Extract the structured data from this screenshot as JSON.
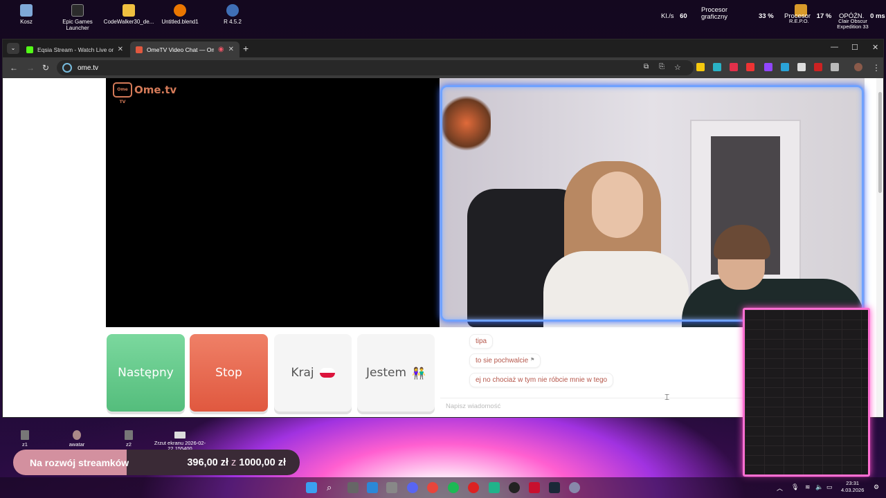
{
  "desktop": {
    "icons": [
      {
        "label": "Kosz",
        "icon": "recycle-bin-icon",
        "color": "#7fa9d8"
      },
      {
        "label": "Epic Games Launcher",
        "icon": "epic-games-icon",
        "color": "#2b2b2b"
      },
      {
        "label": "CodeWalker30_de...",
        "icon": "folder-icon",
        "color": "#f0c040"
      },
      {
        "label": "Untitled.blend1",
        "icon": "blender-icon",
        "color": "#ea7600"
      },
      {
        "label": "R 4.5.2",
        "icon": "r-language-icon",
        "color": "#3f6fb6"
      }
    ],
    "stats": {
      "fps_label": "Kl./s",
      "fps_value": "60",
      "gpu_label": "Procesor graficzny",
      "gpu_value": "33 %",
      "cpu_label": "Procesor",
      "cpu_value": "17 %",
      "game_label": "R.E.P.O.",
      "game2_label": "Clair Obscur Expedition 33",
      "ping_label": "OPÓŹN.",
      "ping_value": "0 ms"
    },
    "bottom_icons": [
      {
        "label": "z1"
      },
      {
        "label": "awatar"
      },
      {
        "label": "z2"
      },
      {
        "label": "Zrzut ekranu 2026-02-22 155400"
      }
    ]
  },
  "browser": {
    "tabs": [
      {
        "label": "Eqsia Stream - Watch Live on K",
        "active": false,
        "favicon_color": "#53fc18"
      },
      {
        "label": "OmeTV Video Chat — Ome",
        "active": true,
        "favicon_color": "#e0583f"
      }
    ],
    "url": "ome.tv"
  },
  "ometv": {
    "logo": "Ome.tv",
    "logo_badge": "Ome TV",
    "buttons": {
      "next": "Następny",
      "stop": "Stop",
      "country": "Kraj",
      "gender": "Jestem"
    },
    "chat": {
      "messages": [
        {
          "text": "tipa",
          "flag": false
        },
        {
          "text": "to sie pochwalcie",
          "flag": true
        },
        {
          "text": "ej no chociaż w tym nie róbcie mnie w tego",
          "flag": false
        }
      ],
      "input_placeholder": "Napisz wiadomość"
    }
  },
  "stream_goal": {
    "label": "Na rozwój streamków",
    "current": "396,00 zł",
    "separator": "z",
    "target": "1000,00 zł",
    "progress": 0.396
  },
  "taskbar": {
    "time": "23:31",
    "date": "4.03.2026"
  },
  "colors": {
    "next_button": "#5cc383",
    "stop_button": "#e5654a",
    "frame_accent": "#6fa2ff",
    "overlay_accent": "#ff6fd2"
  }
}
